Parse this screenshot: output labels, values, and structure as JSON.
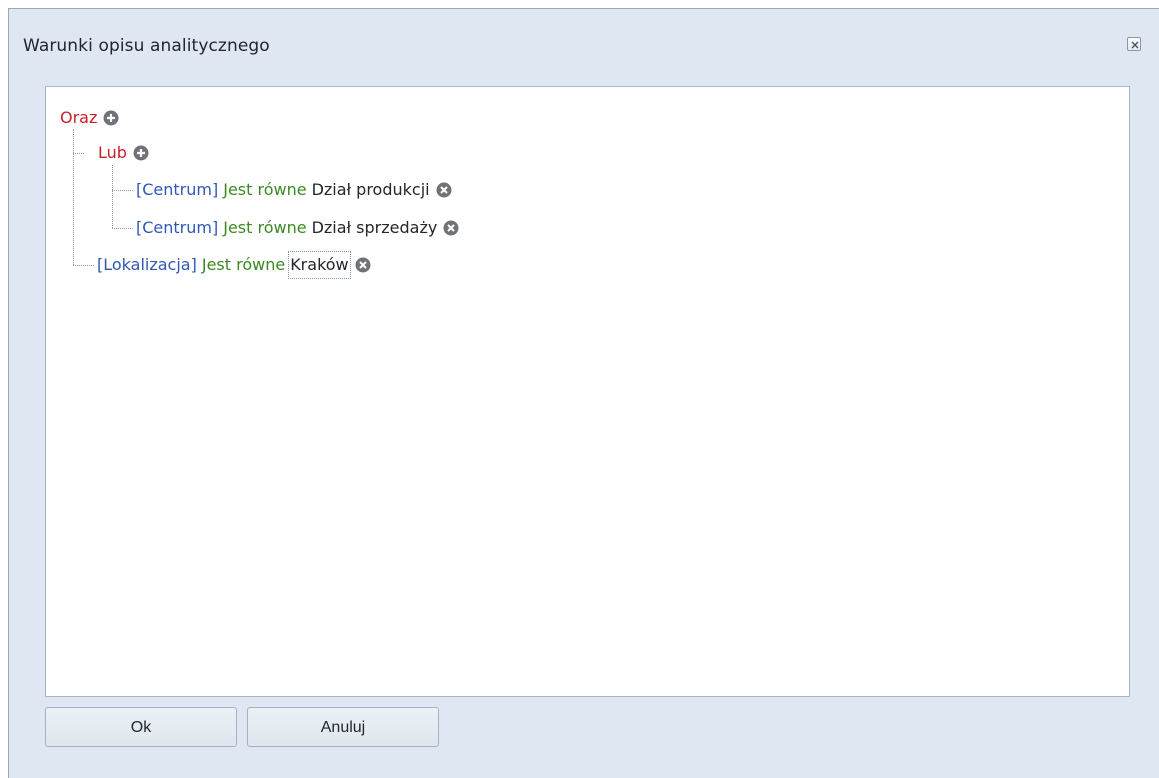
{
  "dialog": {
    "title": "Warunki opisu analitycznego",
    "close_icon": "close-window-icon"
  },
  "tree": {
    "root": {
      "operator": "Oraz",
      "action_icon": "add-circle-icon",
      "children": [
        {
          "operator": "Lub",
          "action_icon": "add-circle-icon",
          "children": [
            {
              "field": "[Centrum]",
              "condition": "Jest równe",
              "value": "Dział produkcji",
              "action_icon": "remove-circle-icon"
            },
            {
              "field": "[Centrum]",
              "condition": "Jest równe",
              "value": "Dział sprzedaży",
              "action_icon": "remove-circle-icon"
            }
          ]
        },
        {
          "field": "[Lokalizacja]",
          "condition": "Jest równe",
          "value": "Kraków",
          "action_icon": "remove-circle-icon"
        }
      ]
    }
  },
  "buttons": {
    "ok": "Ok",
    "cancel": "Anuluj"
  },
  "colors": {
    "operator": "#c8202a",
    "field": "#3158b5",
    "condition": "#3a8a22",
    "value": "#23262b",
    "dialog_background": "#dfe7f2"
  }
}
